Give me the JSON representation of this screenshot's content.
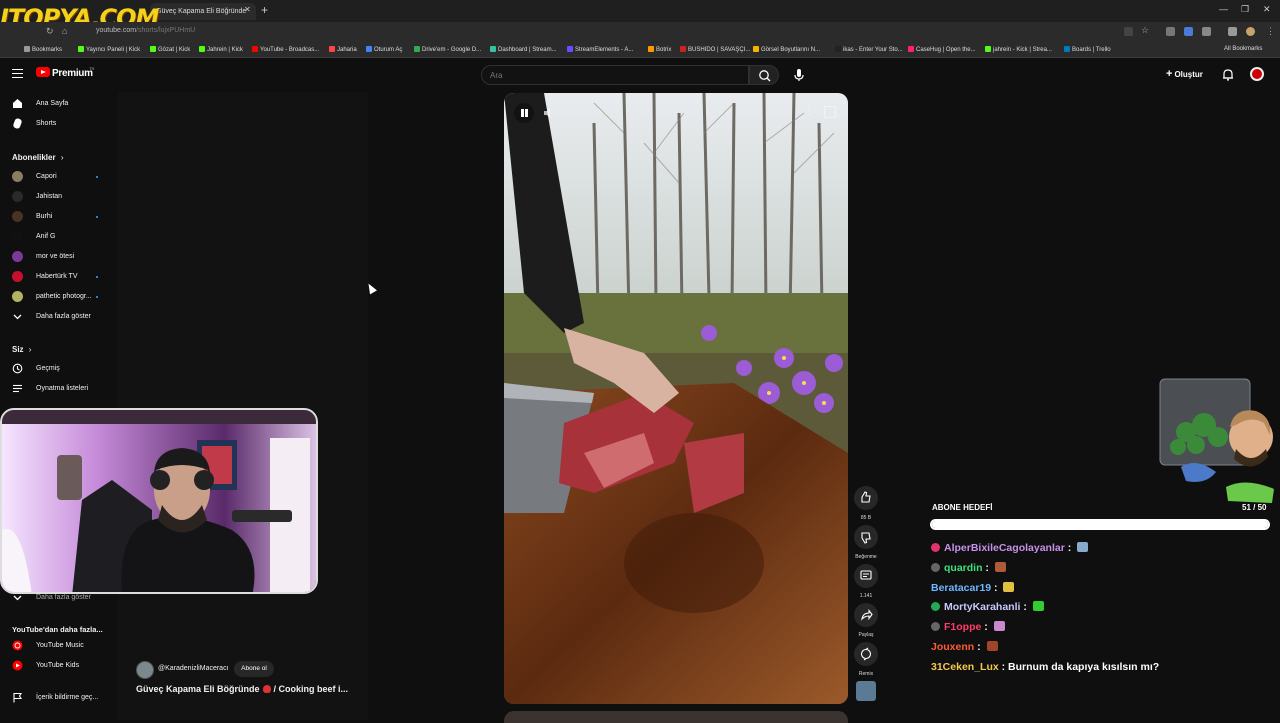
{
  "watermark": "ITOPYA.COM",
  "browser": {
    "active_tab_title": "Güveç Kapama Eli Böğründe",
    "url_host": "youtube.com",
    "url_path": "/shorts/lujxPUHmU",
    "bookmarks": [
      {
        "label": "Bookmarks",
        "color": "#999999"
      },
      {
        "label": "Yayıncı Paneli | Kick",
        "color": "#53fc18"
      },
      {
        "label": "Gözat | Kick",
        "color": "#53fc18"
      },
      {
        "label": "Jahrein | Kick",
        "color": "#53fc18"
      },
      {
        "label": "YouTube - Broadcas...",
        "color": "#ff0000"
      },
      {
        "label": "Jaharia",
        "color": "#ff4444"
      },
      {
        "label": "Oturum Aç",
        "color": "#4285f4"
      },
      {
        "label": "Drive'em - Google D...",
        "color": "#34a853"
      },
      {
        "label": "Dashboard | Stream...",
        "color": "#31c3a2"
      },
      {
        "label": "StreamElements - A...",
        "color": "#6c4cff"
      },
      {
        "label": "Botrix",
        "color": "#ff9900"
      },
      {
        "label": "BUSHIDO | SAVAŞÇI...",
        "color": "#cc2222"
      },
      {
        "label": "Görsel Boyutlarını N...",
        "color": "#f4b400"
      },
      {
        "label": "ikas - Enter Your Sto...",
        "color": "#222222"
      },
      {
        "label": "CaseHug | Open the...",
        "color": "#ff2266"
      },
      {
        "label": "jahrein - Kick | Strea...",
        "color": "#53fc18"
      },
      {
        "label": "Boards | Trello",
        "color": "#0079bf"
      }
    ],
    "all_bookmarks_label": "All Bookmarks"
  },
  "masthead": {
    "logo_text": "Premium",
    "country_code": "TR",
    "search_placeholder": "Ara",
    "create_label": "Oluştur"
  },
  "sidebar": {
    "home": "Ana Sayfa",
    "shorts": "Shorts",
    "subscriptions_title": "Abonelikler",
    "channels": [
      {
        "name": "Capori",
        "color": "#8a7d60",
        "dot": true
      },
      {
        "name": "Jahistan",
        "color": "#2a2a2a",
        "dot": false
      },
      {
        "name": "Burhi",
        "color": "#4a3322",
        "dot": true
      },
      {
        "name": "Anif G",
        "color": "#111111",
        "dot": false
      },
      {
        "name": "mor ve ötesi",
        "color": "#7a3a9a",
        "dot": false
      },
      {
        "name": "Habertürk TV",
        "color": "#c8102e",
        "dot": true
      },
      {
        "name": "pathetic photogr...",
        "color": "#b3b364",
        "dot": true
      }
    ],
    "show_more": "Daha fazla göster",
    "you_title": "Siz",
    "history": "Geçmiş",
    "playlists": "Oynatma listeleri",
    "show_more_2": "Daha fazla göster",
    "more_from_yt_title": "YouTube'dan daha fazla...",
    "yt_music": "YouTube Music",
    "yt_kids": "YouTube Kids",
    "report_history": "İçerik bildirme geç..."
  },
  "short": {
    "channel_handle": "@KaradenizliMaceracı",
    "subscribe_label": "Abone ol",
    "title_part1": "Güveç Kapama Eli Böğründe",
    "title_part2": "/ Cooking beef i...",
    "like_count": "85 B",
    "dislike_label": "Beğenme",
    "comment_count": "1.141",
    "share_label": "Paylaş",
    "remix_label": "Remix"
  },
  "overlay": {
    "goal_title": "ABONE HEDEFİ",
    "goal_count": "51 / 50",
    "goal_progress": 1.0,
    "chat": [
      {
        "user": "AlperBixileCagolayanlar",
        "color": "#c792ea",
        "badge": "#e0336a",
        "emote": "#88aacc",
        "message": ""
      },
      {
        "user": "quardin",
        "color": "#3de07a",
        "badge": "#666666",
        "emote": "#b05a3a",
        "message": ""
      },
      {
        "user": "Beratacar19",
        "color": "#6fb7ff",
        "badge": "",
        "emote": "#e0c040",
        "message": ""
      },
      {
        "user": "MortyKarahanli",
        "color": "#c8c8ff",
        "badge": "#22aa55",
        "emote": "#33cc33",
        "message": ""
      },
      {
        "user": "F1oppe",
        "color": "#ff3b6b",
        "badge": "#666666",
        "emote": "#cc88cc",
        "message": ""
      },
      {
        "user": "Jouxenn",
        "color": "#ff5a36",
        "badge": "",
        "emote": "#a0442a",
        "message": ""
      },
      {
        "user": "31Ceken_Lux",
        "color": "#f5c84c",
        "badge": "",
        "emote": "",
        "message": "Burnum da kapıya kısılsın mı?"
      }
    ]
  }
}
